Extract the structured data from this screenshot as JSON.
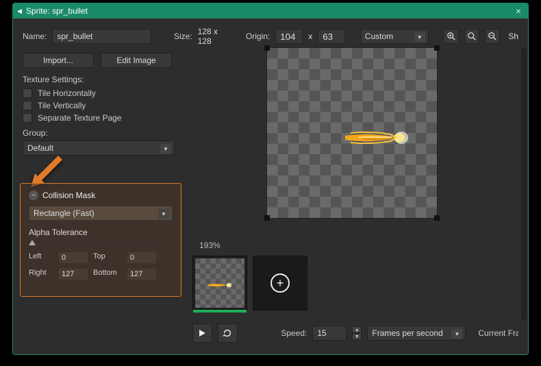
{
  "titlebar": {
    "title": "Sprite: spr_bullet"
  },
  "name": {
    "label": "Name:",
    "value": "spr_bullet"
  },
  "size": {
    "label": "Size:",
    "value": "128 x 128"
  },
  "origin": {
    "label": "Origin:",
    "x": "104",
    "sep": "x",
    "y": "63",
    "mode": "Custom"
  },
  "truncated": "Sh",
  "buttons": {
    "import": "Import...",
    "edit": "Edit Image"
  },
  "texture": {
    "heading": "Texture Settings:",
    "tile_h": "Tile Horizontally",
    "tile_v": "Tile Vertically",
    "sep": "Separate Texture Page"
  },
  "group": {
    "label": "Group:",
    "value": "Default"
  },
  "mask": {
    "heading": "Collision Mask",
    "shape": "Rectangle (Fast)",
    "alpha_label": "Alpha Tolerance",
    "left_l": "Left",
    "left_v": "0",
    "top_l": "Top",
    "top_v": "0",
    "right_l": "Right",
    "right_v": "127",
    "bottom_l": "Bottom",
    "bottom_v": "127"
  },
  "zoom": "193%",
  "play": {
    "speed_l": "Speed:",
    "speed_v": "15",
    "mode": "Frames per second",
    "cut": "Current Fra"
  }
}
